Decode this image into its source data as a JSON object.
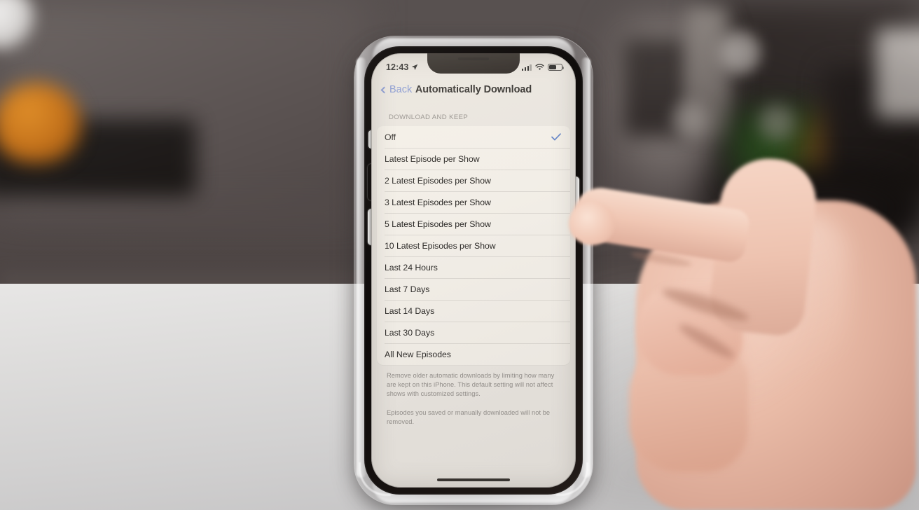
{
  "device": {
    "name": "iphone",
    "case": "clear-case"
  },
  "status_bar": {
    "time": "12:43",
    "location_icon": "location-arrow-icon",
    "cellular_icon": "cellular-bars-icon",
    "wifi_icon": "wifi-icon",
    "battery_icon": "battery-icon",
    "battery_level_percent": 62
  },
  "nav": {
    "back_label": "Back",
    "back_icon": "chevron-left-icon",
    "title": "Automatically Download"
  },
  "section": {
    "header": "DOWNLOAD AND KEEP",
    "selected_index": 0,
    "check_icon": "checkmark-icon",
    "check_color": "#5b7fc7",
    "options": [
      {
        "label": "Off",
        "selected": true
      },
      {
        "label": "Latest Episode per Show",
        "selected": false
      },
      {
        "label": "2 Latest Episodes per Show",
        "selected": false
      },
      {
        "label": "3 Latest Episodes per Show",
        "selected": false
      },
      {
        "label": "5 Latest Episodes per Show",
        "selected": false
      },
      {
        "label": "10 Latest Episodes per Show",
        "selected": false
      },
      {
        "label": "Last 24 Hours",
        "selected": false
      },
      {
        "label": "Last 7 Days",
        "selected": false
      },
      {
        "label": "Last 14 Days",
        "selected": false
      },
      {
        "label": "Last 30 Days",
        "selected": false
      },
      {
        "label": "All New Episodes",
        "selected": false
      }
    ]
  },
  "footnotes": [
    "Remove older automatic downloads by limiting how many are kept on this iPhone. This default setting will not affect shows with customized settings.",
    "Episodes you saved or manually downloaded will not be removed."
  ],
  "home_indicator": "home-indicator",
  "colors": {
    "accent_blue": "#7b8fd0",
    "screen_bg": "#e9e5df",
    "cell_bg": "#f3efe8",
    "text_primary": "#22201e",
    "text_secondary": "#8c8884"
  }
}
